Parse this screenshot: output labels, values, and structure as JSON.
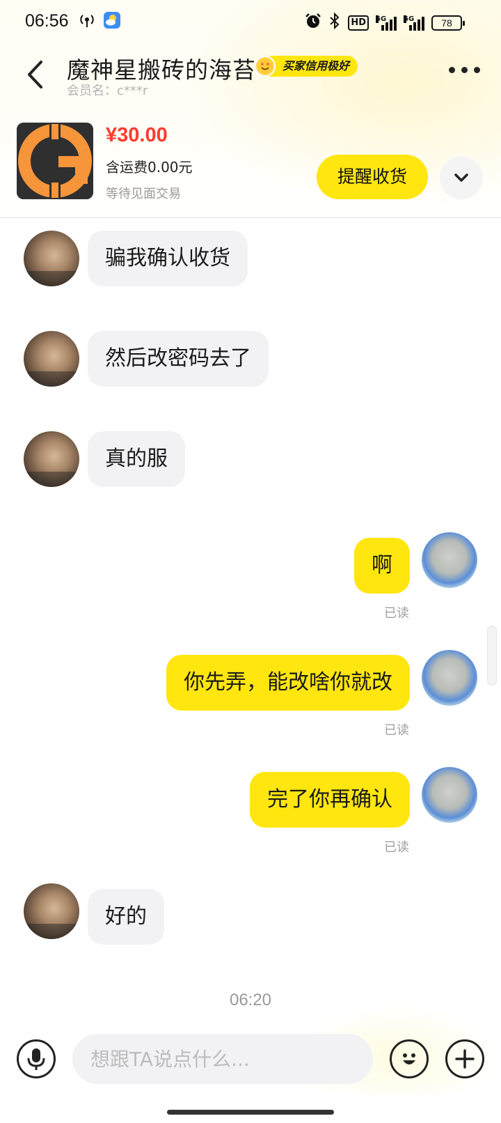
{
  "status_bar": {
    "time": "06:56",
    "left_icons": [
      "hotspot-icon",
      "weather-icon"
    ],
    "right_icons": [
      "alarm-icon",
      "bluetooth-icon",
      "hd-icon",
      "signal-5g-icon",
      "signal-5g-icon"
    ],
    "hd_label": "HD",
    "signal1_label": "5G",
    "signal2_label": "5G",
    "battery": "78"
  },
  "header": {
    "title": "魔神星搬砖的海苔",
    "credit_badge": "买家信用极好",
    "member": "会员名：c***r",
    "back_icon": "chevron-left-icon",
    "more_icon": "more-horizontal-icon"
  },
  "item": {
    "thumbnail_icon": "g-coin-logo-icon",
    "price": "¥30.00",
    "shipping": "含运费0.00元",
    "status": "等待见面交易",
    "remind_label": "提醒收货",
    "expand_icon": "chevron-down-icon"
  },
  "messages": [
    {
      "side": "in",
      "text": "骗我确认收货"
    },
    {
      "side": "in",
      "text": "然后改密码去了"
    },
    {
      "side": "in",
      "text": "真的服"
    },
    {
      "side": "out",
      "text": "啊",
      "status": "已读"
    },
    {
      "side": "out",
      "text": "你先弄，能改啥你就改",
      "status": "已读"
    },
    {
      "side": "out",
      "text": "完了你再确认",
      "status": "已读"
    },
    {
      "side": "in",
      "text": "好的"
    }
  ],
  "timestamp": "06:20",
  "input_bar": {
    "placeholder": "想跟TA说点什么...",
    "value": "",
    "voice_icon": "microphone-icon",
    "emoji_icon": "emoji-icon",
    "plus_icon": "plus-icon"
  },
  "colors": {
    "accent": "#ffe60f",
    "price": "#ff3b30",
    "incoming_bubble": "#f2f2f4",
    "outgoing_bubble": "#ffe60f"
  }
}
